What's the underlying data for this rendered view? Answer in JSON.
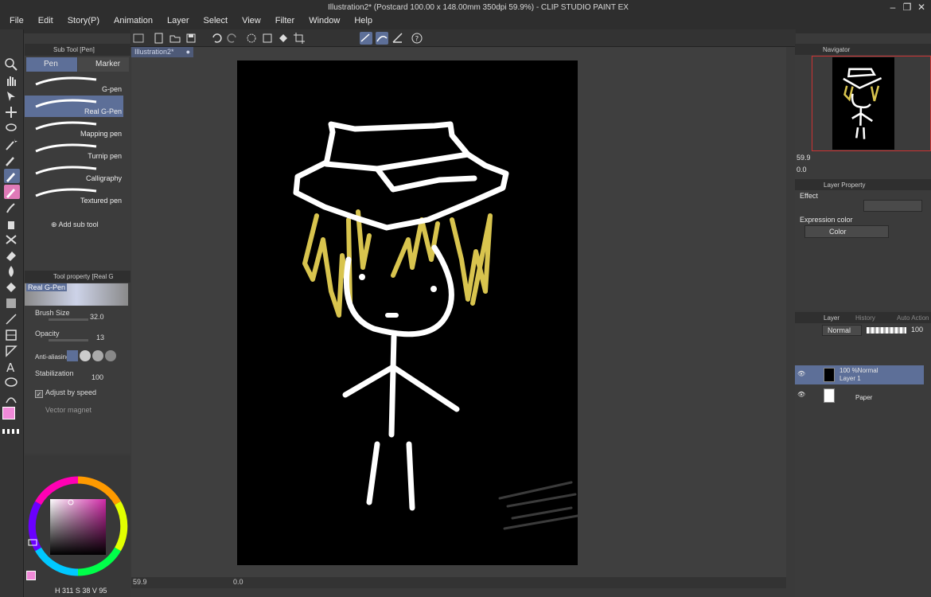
{
  "app": {
    "title": "Illustration2* (Postcard 100.00 x 148.00mm 350dpi 59.9%)  - CLIP STUDIO PAINT EX"
  },
  "menu": [
    "File",
    "Edit",
    "Story(P)",
    "Animation",
    "Layer",
    "Select",
    "View",
    "Filter",
    "Window",
    "Help"
  ],
  "document_tab": "Illustration2*",
  "subtool_panel": {
    "title": "Sub Tool [Pen]",
    "tabs": [
      "Pen",
      "Marker"
    ],
    "brushes": [
      "G-pen",
      "Real G-Pen",
      "Mapping pen",
      "Turnip pen",
      "Calligraphy",
      "Textured pen"
    ],
    "selected_brush": "Real G-Pen",
    "add_label": "Add sub tool"
  },
  "tool_property": {
    "title": "Tool property [Real G",
    "preset_name": "Real G-Pen",
    "brush_size_label": "Brush Size",
    "brush_size": "32.0",
    "opacity_label": "Opacity",
    "opacity": "13",
    "anti_aliasing_label": "Anti-aliasing",
    "stabilization_label": "Stabilization",
    "stabilization": "100",
    "adjust_speed_label": "Adjust by speed",
    "vector_magnet_label": "Vector magnet"
  },
  "color_panel": {
    "h": "311",
    "s": "38",
    "v": "95",
    "main_color": "#f08ad8"
  },
  "status": {
    "zoom": "59.9",
    "rotate": "0.0"
  },
  "navigator": {
    "title": "Navigator",
    "zoom": "59.9",
    "angle": "0.0"
  },
  "layer_property": {
    "title": "Layer Property",
    "effect_label": "Effect",
    "expression_label": "Expression color",
    "expression_value": "Color"
  },
  "layer_panel": {
    "tabs": [
      "Layer",
      "History",
      "Auto Action"
    ],
    "blend_mode": "Normal",
    "opacity": "100",
    "layers": [
      {
        "name": "Layer 1",
        "info": "100 %Normal",
        "selected": true
      },
      {
        "name": "Paper",
        "info": "",
        "selected": false
      }
    ]
  },
  "colors": {
    "accent": "#5d6f98",
    "hair": "#d8c44e",
    "ink": "#ffffff"
  }
}
